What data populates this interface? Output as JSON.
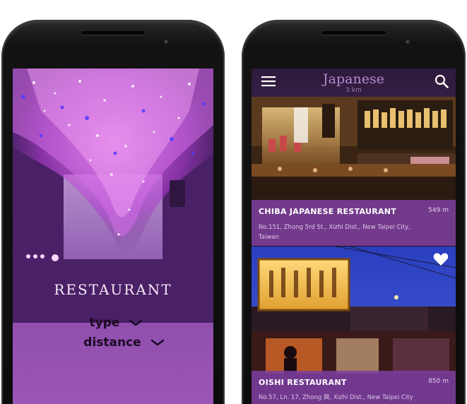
{
  "left_screen": {
    "title": "RESTAURANT",
    "filters": [
      {
        "label": "type",
        "icon": "chevron-down-icon"
      },
      {
        "label": "distance",
        "icon": "chevron-down-icon"
      }
    ]
  },
  "right_screen": {
    "appbar": {
      "title": "Japanese",
      "subtitle": "3 km",
      "menu_icon": "menu-icon",
      "search_icon": "search-icon"
    },
    "restaurants": [
      {
        "name": "CHIBA JAPANESE RESTAURANT",
        "distance": "549 m",
        "address": "No.151, Zhong 5rd St., Xizhi Dist., New Taipei City, Taiwan",
        "favorite": false
      },
      {
        "name": "OISHI RESTAURANT",
        "distance": "850 m",
        "address": "No.57, Ln. 17, Zhong 興, Xizhi Dist., New Taipei City",
        "favorite": true
      }
    ]
  },
  "colors": {
    "accent_purple": "#7d3ea0",
    "appbar_bg": "#341f44",
    "title_purple": "#b58ad0"
  }
}
